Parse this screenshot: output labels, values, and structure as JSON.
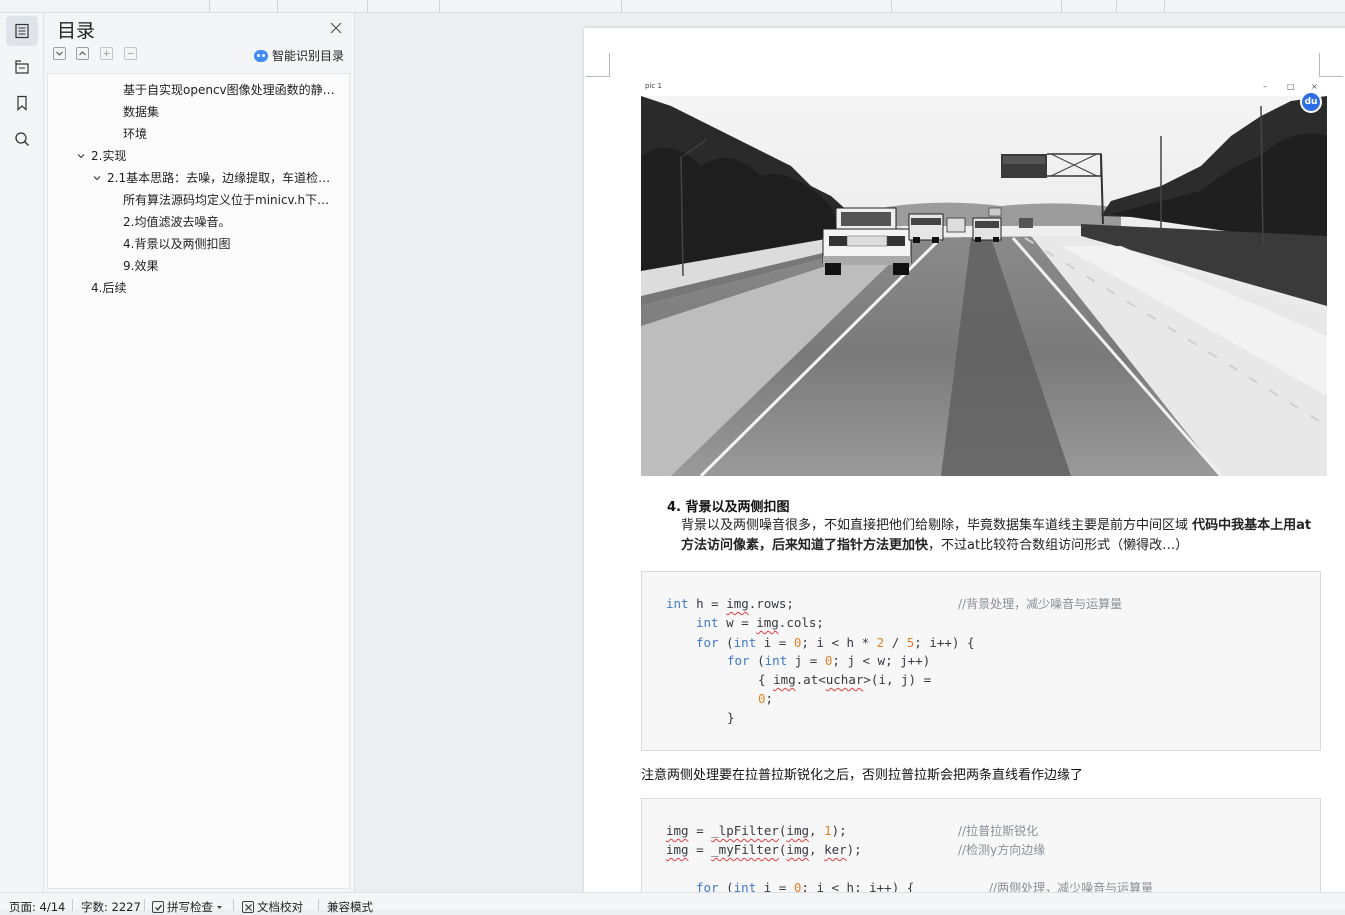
{
  "toc": {
    "title": "目录",
    "smart_button_label": "智能识别目录",
    "items": [
      {
        "label": "基于自实现opencv图像处理函数的静…",
        "level": 3,
        "has_chevron": false
      },
      {
        "label": "数据集",
        "level": 3,
        "has_chevron": false
      },
      {
        "label": "环境",
        "level": 3,
        "has_chevron": false
      },
      {
        "label": "2.实现",
        "level": 1,
        "has_chevron": true
      },
      {
        "label": "2.1基本思路：去噪，边缘提取，车道检…",
        "level": 2,
        "has_chevron": true
      },
      {
        "label": "所有算法源码均定义位于minicv.h下…",
        "level": 3,
        "has_chevron": false
      },
      {
        "label": "2.均值滤波去噪音。",
        "level": 3,
        "has_chevron": false
      },
      {
        "label": "4.背景以及两侧扣图",
        "level": 3,
        "has_chevron": false
      },
      {
        "label": "9.效果",
        "level": 3,
        "has_chevron": false
      },
      {
        "label": "4.后续",
        "level": 1,
        "has_chevron": false
      }
    ]
  },
  "document": {
    "image_window_title": "pic 1",
    "image_badge": "du",
    "section_heading": "4. 背景以及两侧扣图",
    "para_plain1": "背景以及两侧噪音很多，不如直接把他们给剔除，毕竟数据集车道线主要是前方中间区域 ",
    "para_bold": "代码中我基本上用at方法访问像素，后来知道了指针方法更加快",
    "para_plain2": "，不过at比较符合数组访问形式（懒得改…）",
    "note": "注意两侧处理要在拉普拉斯锐化之后，否则拉普拉斯会把两条直线看作边缘了",
    "code1_comment1": "//背景处理，减少噪音与运算量",
    "code2_comment1": "//拉普拉斯锐化",
    "code2_comment2": "//检测y方向边缘",
    "code2_comment3": "//两侧处理，减少噪音与运算量"
  },
  "status": {
    "page": "页面: 4/14",
    "words": "字数: 2227",
    "spell": "拼写检查",
    "proof": "文档校对",
    "compat": "兼容模式"
  },
  "colors": {
    "accent": "#3f8cf3",
    "keyword": "#4078c8",
    "number": "#e0822c",
    "comment": "#8a8f98"
  }
}
